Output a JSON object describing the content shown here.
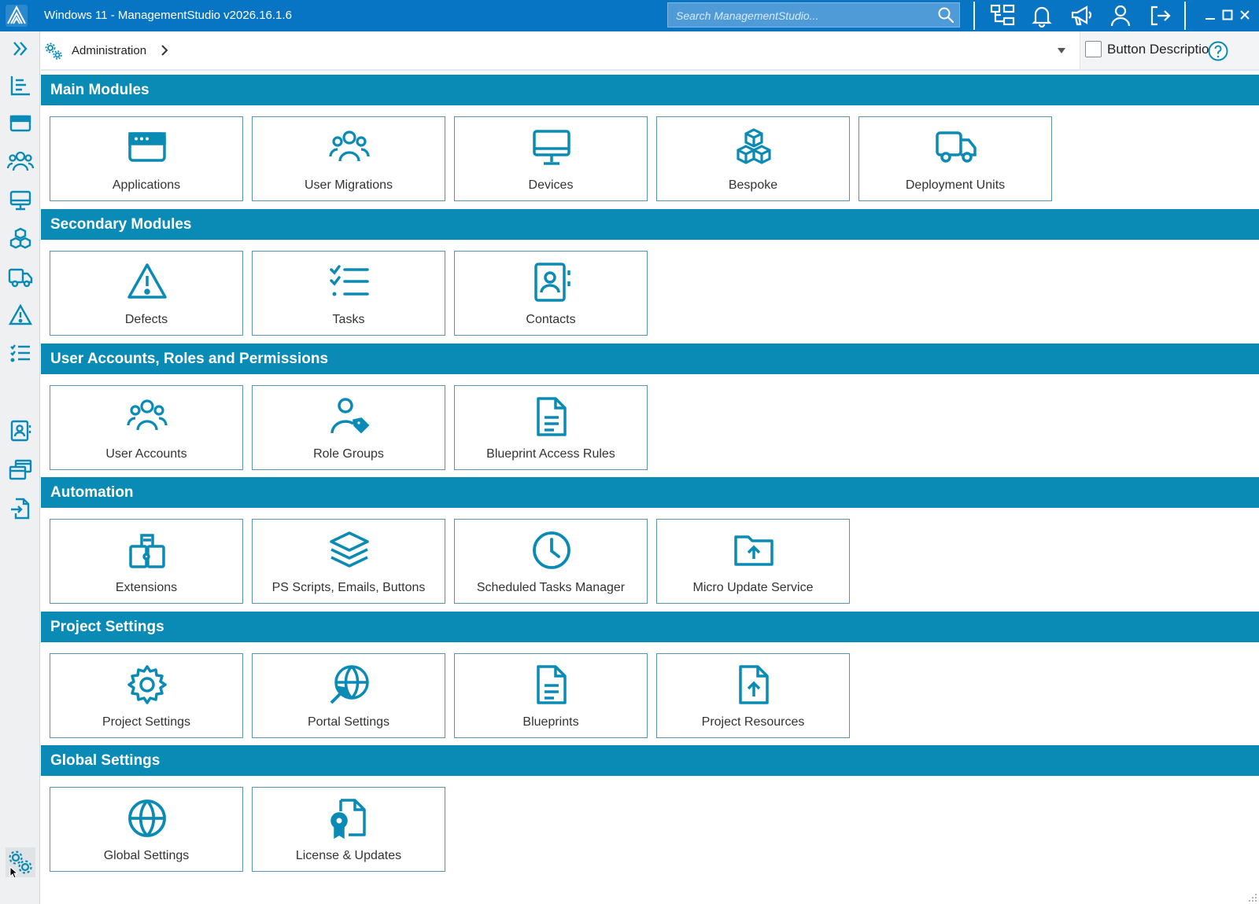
{
  "window": {
    "title": "Windows 11 - ManagementStudio v2026.16.1.6",
    "search_placeholder": "Search ManagementStudio..."
  },
  "breadcrumb": {
    "current": "Administration"
  },
  "toolbar": {
    "button_descriptions_label": "Button Descriptions",
    "button_descriptions_checked": false
  },
  "colors": {
    "titlebar": "#0874c4",
    "section_header": "#0a8bb5",
    "icon_accent": "#0a8bb5"
  },
  "sidebar": {
    "items": [
      {
        "icon": "chevrons-right-icon"
      },
      {
        "icon": "dashboard-list-icon"
      },
      {
        "icon": "applications-icon"
      },
      {
        "icon": "users-icon"
      },
      {
        "icon": "monitor-icon"
      },
      {
        "icon": "cubes-icon"
      },
      {
        "icon": "truck-icon"
      },
      {
        "icon": "warning-icon"
      },
      {
        "icon": "checklist-icon"
      },
      {
        "icon": "contact-card-icon"
      },
      {
        "icon": "windows-stack-icon"
      },
      {
        "icon": "file-import-icon"
      },
      {
        "icon": "gears-icon"
      }
    ]
  },
  "sections": [
    {
      "title": "Main Modules",
      "tiles": [
        {
          "label": "Applications",
          "icon": "window-icon"
        },
        {
          "label": "User Migrations",
          "icon": "users-icon"
        },
        {
          "label": "Devices",
          "icon": "monitor-icon"
        },
        {
          "label": "Bespoke",
          "icon": "cubes-icon"
        },
        {
          "label": "Deployment Units",
          "icon": "truck-icon"
        }
      ]
    },
    {
      "title": "Secondary Modules",
      "tiles": [
        {
          "label": "Defects",
          "icon": "warning-icon"
        },
        {
          "label": "Tasks",
          "icon": "checklist-icon"
        },
        {
          "label": "Contacts",
          "icon": "contact-card-icon"
        }
      ]
    },
    {
      "title": "User Accounts, Roles and Permissions",
      "tiles": [
        {
          "label": "User Accounts",
          "icon": "users-icon"
        },
        {
          "label": "Role Groups",
          "icon": "user-tag-icon"
        },
        {
          "label": "Blueprint Access Rules",
          "icon": "document-icon"
        }
      ]
    },
    {
      "title": "Automation",
      "tiles": [
        {
          "label": "Extensions",
          "icon": "puzzle-icon"
        },
        {
          "label": "PS Scripts, Emails, Buttons",
          "icon": "layers-icon"
        },
        {
          "label": "Scheduled Tasks Manager",
          "icon": "clock-icon"
        },
        {
          "label": "Micro Update Service",
          "icon": "folder-upload-icon"
        }
      ]
    },
    {
      "title": "Project Settings",
      "tiles": [
        {
          "label": "Project Settings",
          "icon": "gear-icon"
        },
        {
          "label": "Portal Settings",
          "icon": "globe-arrow-icon"
        },
        {
          "label": "Blueprints",
          "icon": "document-icon"
        },
        {
          "label": "Project Resources",
          "icon": "file-upload-icon"
        }
      ]
    },
    {
      "title": "Global Settings",
      "tiles": [
        {
          "label": "Global Settings",
          "icon": "globe-icon"
        },
        {
          "label": "License & Updates",
          "icon": "license-icon"
        }
      ]
    }
  ]
}
